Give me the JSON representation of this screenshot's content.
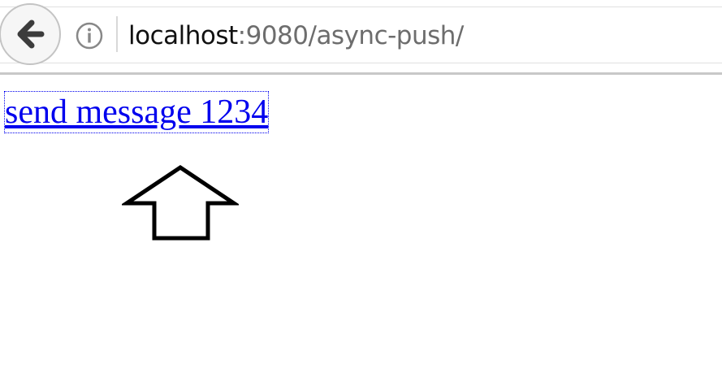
{
  "browser": {
    "back_icon": "back-arrow-icon",
    "info_icon": "info-icon",
    "url_host": "localhost",
    "url_rest": ":9080/async-push/"
  },
  "page": {
    "link_text": "send message 1234",
    "link_color": "#0000ee",
    "annotation_icon": "up-arrow-icon"
  }
}
